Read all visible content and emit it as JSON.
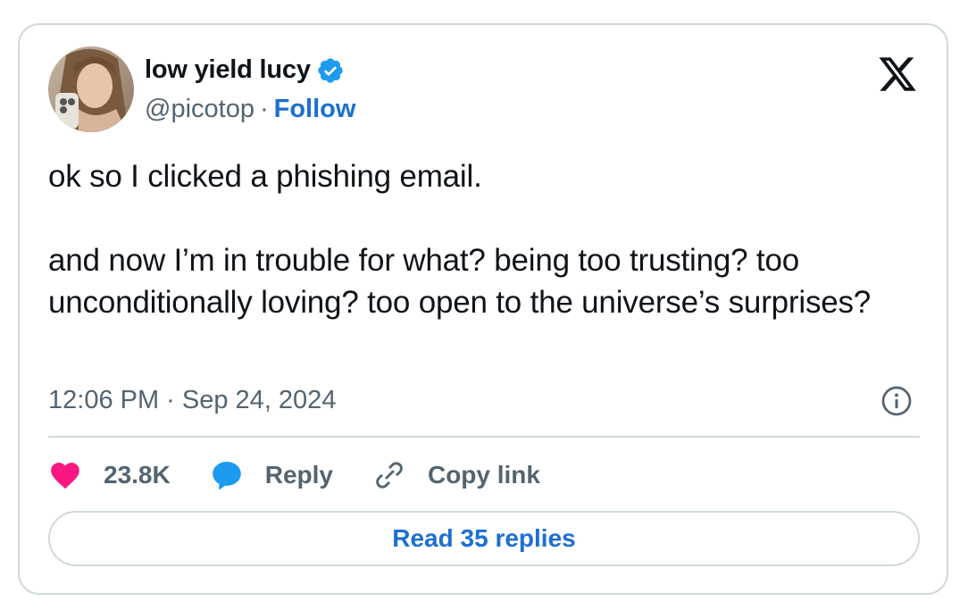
{
  "author": {
    "name": "low yield lucy",
    "handle": "@picotop",
    "separator": "·",
    "follow_label": "Follow"
  },
  "tweet": {
    "paragraph_1": "ok so I clicked a phishing email.",
    "paragraph_2": "and now I’m in trouble for what? being too trusting? too unconditionally loving? too open to the universe’s surprises?",
    "timestamp": "12:06 PM · Sep 24, 2024"
  },
  "actions": {
    "likes_count": "23.8K",
    "reply_label": "Reply",
    "copy_link_label": "Copy link"
  },
  "read_replies_label": "Read 35 replies",
  "icons": {
    "verified": "verified-badge-icon",
    "logo": "x-logo-icon",
    "info": "info-icon",
    "like": "heart-icon",
    "reply": "speech-bubble-icon",
    "copy": "link-icon"
  },
  "colors": {
    "accent_blue": "#1d6fd1",
    "verified_blue": "#1d9bf0",
    "heart_pink": "#f91880",
    "muted_text": "#536471",
    "border": "#cfd9de"
  }
}
